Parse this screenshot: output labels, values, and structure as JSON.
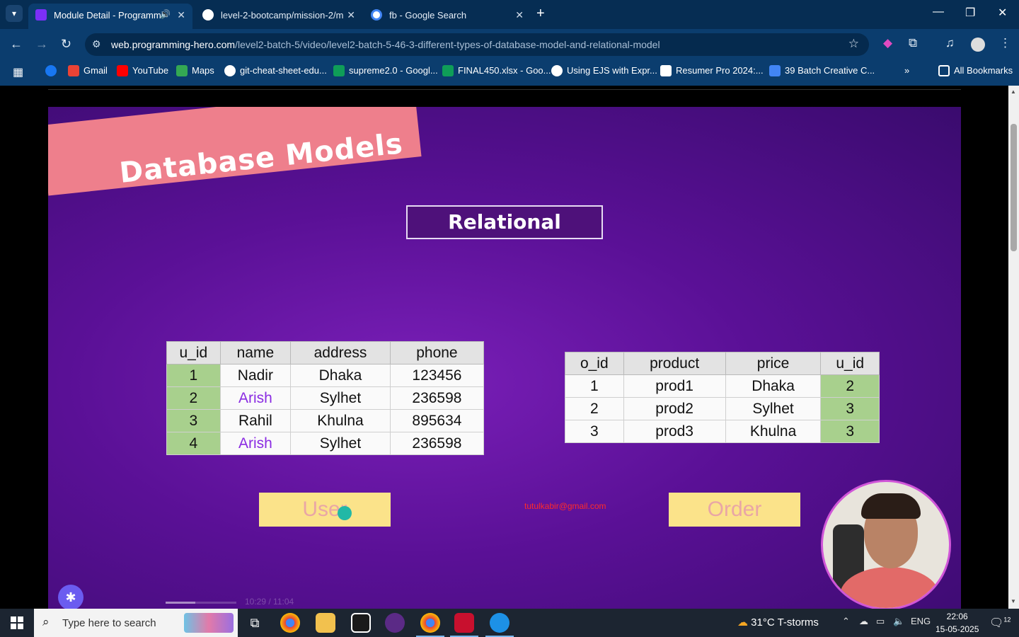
{
  "browser": {
    "tabs": [
      {
        "title": "Module Detail - Programmi",
        "active": true
      },
      {
        "title": "level-2-bootcamp/mission-2/m",
        "active": false
      },
      {
        "title": "fb - Google Search",
        "active": false
      }
    ],
    "url_host": "web.programming-hero.com",
    "url_path": "/level2-batch-5/video/level2-batch-5-46-3-different-types-of-database-model-and-relational-model",
    "bookmarks": [
      "Gmail",
      "YouTube",
      "Maps",
      "git-cheat-sheet-edu...",
      "supreme2.0 - Googl...",
      "FINAL450.xlsx - Goo...",
      "Using EJS with Expr...",
      "Resumer Pro 2024:...",
      "39 Batch Creative C..."
    ],
    "all_bookmarks": "All Bookmarks"
  },
  "slide": {
    "title": "Database Models",
    "subtitle": "Relational",
    "users_table": {
      "headers": [
        "u_id",
        "name",
        "address",
        "phone"
      ],
      "rows": [
        [
          "1",
          "Nadir",
          "Dhaka",
          "123456"
        ],
        [
          "2",
          "Arish",
          "Sylhet",
          "236598"
        ],
        [
          "3",
          "Rahil",
          "Khulna",
          "895634"
        ],
        [
          "4",
          "Arish",
          "Sylhet",
          "236598"
        ]
      ]
    },
    "orders_table": {
      "headers": [
        "o_id",
        "product",
        "price",
        "u_id"
      ],
      "rows": [
        [
          "1",
          "prod1",
          "Dhaka",
          "2"
        ],
        [
          "2",
          "prod2",
          "Sylhet",
          "3"
        ],
        [
          "3",
          "prod3",
          "Khulna",
          "3"
        ]
      ]
    },
    "user_caption": "User",
    "order_caption": "Order",
    "email": "tutulkabir@gmail.com"
  },
  "player": {
    "timecode": "10:29 / 11:04",
    "progress": 0.42
  },
  "taskbar": {
    "search_placeholder": "Type here to search",
    "weather": "31°C  T-storms",
    "language": "ENG",
    "time": "22:06",
    "date": "15-05-2025",
    "notification_count": "12"
  }
}
